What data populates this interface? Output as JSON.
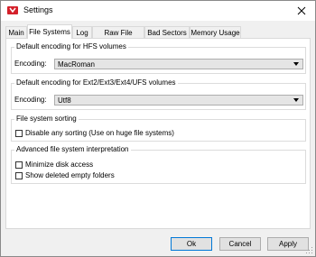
{
  "window": {
    "title": "Settings"
  },
  "tabs": [
    {
      "label": "Main",
      "active": false
    },
    {
      "label": "File Systems",
      "active": true
    },
    {
      "label": "Log",
      "active": false
    },
    {
      "label": "Raw File Search",
      "active": false
    },
    {
      "label": "Bad Sectors",
      "active": false
    },
    {
      "label": "Memory Usage",
      "active": false
    }
  ],
  "hfs": {
    "group_title": "Default encoding for HFS volumes",
    "encoding_label": "Encoding:",
    "encoding_value": "MacRoman"
  },
  "ext": {
    "group_title": "Default encoding for Ext2/Ext3/Ext4/UFS volumes",
    "encoding_label": "Encoding:",
    "encoding_value": "Utf8"
  },
  "sorting": {
    "group_title": "File system sorting",
    "disable_sorting_label": "Disable any sorting (Use on huge file systems)",
    "disable_sorting_checked": false
  },
  "advanced": {
    "group_title": "Advanced file system interpretation",
    "minimize_label": "Minimize disk access",
    "minimize_checked": false,
    "show_deleted_label": "Show deleted empty folders",
    "show_deleted_checked": false
  },
  "buttons": {
    "ok": "Ok",
    "cancel": "Cancel",
    "apply": "Apply"
  },
  "colors": {
    "accent": "#0078d7",
    "app_icon": "#d4202a"
  }
}
